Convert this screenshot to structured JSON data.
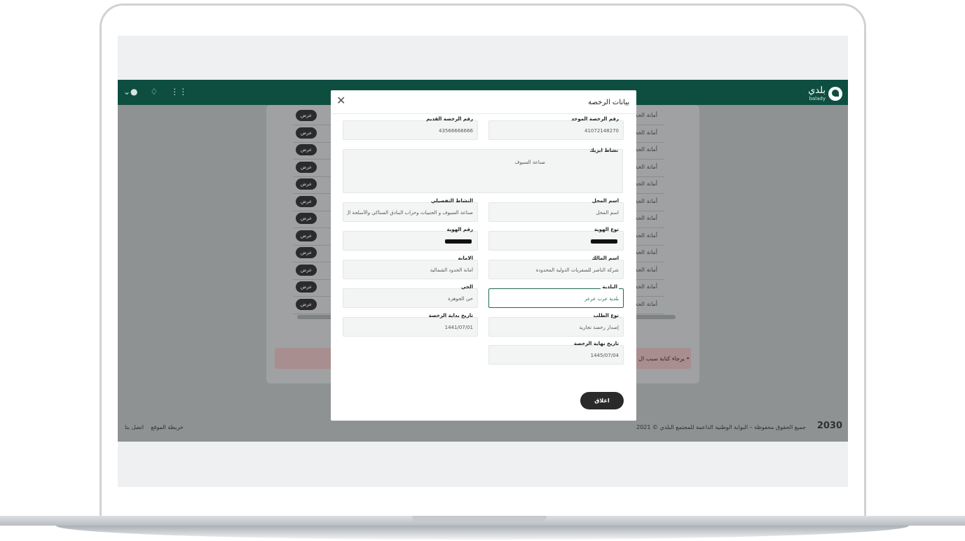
{
  "app": {
    "brand_name": "بلدي",
    "brand_sub": "balady"
  },
  "nav_icons": [
    "grid-icon",
    "bell-icon",
    "user-icon",
    "chevron-down-icon"
  ],
  "background_list": {
    "button_label": "عرض",
    "row_label": "أمانة الحد",
    "rows": 12
  },
  "alert": {
    "text": "• يرجاء كتابة سبب ال"
  },
  "footer": {
    "links": [
      "اتصل بنا",
      "خريطة الموقع"
    ],
    "copyright": "جميع الحقوق محفوظة – البوابة الوطنية الداعمة للمجتمع البلدي © 2021",
    "vision": "2030"
  },
  "modal": {
    "title": "بيانات الرخصة",
    "close_label": "اغلاق",
    "fields": {
      "unified_license": {
        "label": "رقم الرخصة الموحد",
        "value": "41072148270"
      },
      "old_license": {
        "label": "رقم الرخصة القديم",
        "value": "43566666666"
      },
      "isic_activity": {
        "label": "نشاط ايزيك",
        "value": "صناعة السيوف"
      },
      "shop_name": {
        "label": "اسم المحل",
        "value": "اسم المحل"
      },
      "detailed_activity": {
        "label": "النشاط التفصيلي",
        "value": "صناعة السيوف و الجنبيات وحراب البنادق السناكي والأسلحة ال"
      },
      "id_type": {
        "label": "نوع الهوية",
        "value": ""
      },
      "id_number": {
        "label": "رقم الهوية",
        "value": ""
      },
      "owner_name": {
        "label": "اسم المالك",
        "value": "شركة الناصر للسفريات الدولية المحدودة"
      },
      "amanah": {
        "label": "الامانة",
        "value": "أمانة الحدود الشمالية"
      },
      "municipality": {
        "label": "البلدية",
        "value": "بلدية عرب عرعر"
      },
      "district": {
        "label": "الحي",
        "value": "حي الجوهرة"
      },
      "request_type": {
        "label": "نوع الطلب",
        "value": "إصدار رخصة تجارية"
      },
      "license_start": {
        "label": "تاريخ بداية الرخصة",
        "value": "1441/07/01"
      },
      "license_end": {
        "label": "تاريخ نهاية الرخصة",
        "value": "1445/07/04"
      }
    }
  }
}
